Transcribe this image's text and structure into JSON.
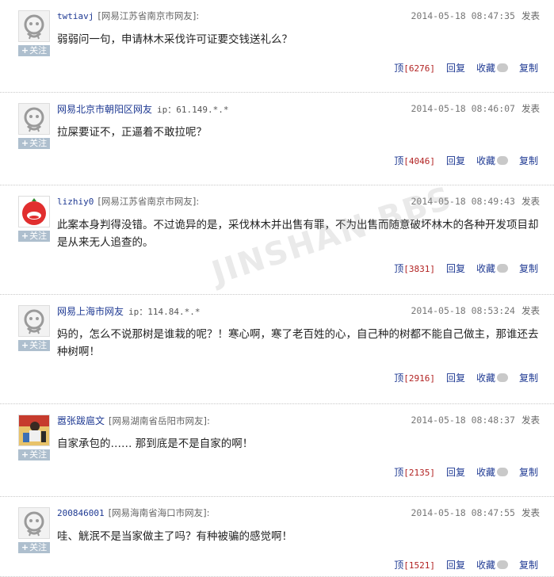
{
  "follow_label": "关注",
  "actions": {
    "ding": "顶",
    "reply": "回复",
    "collect": "收藏",
    "copy": "复制"
  },
  "publish_label": "发表",
  "watermark": "JINSHAN BBS",
  "comments": [
    {
      "user": "twtiavj",
      "location": "[网易江苏省南京市网友]:",
      "ip": "",
      "time": "2014-05-18 08:47:35",
      "content": "弱弱问一句，申请林木采伐许可证要交钱送礼么？",
      "ding": "[6276]",
      "avatar": "default"
    },
    {
      "user": "网易北京市朝阳区网友",
      "location": "",
      "ip": "ip：61.149.*.*",
      "time": "2014-05-18 08:46:07",
      "content": "拉屎要证不，正逼着不敢拉呢？",
      "ding": "[4046]",
      "avatar": "default"
    },
    {
      "user": "lizhiy0",
      "location": "[网易江苏省南京市网友]:",
      "ip": "",
      "time": "2014-05-18 08:49:43",
      "content": "此案本身判得没错。不过诡异的是，采伐林木并出售有罪，不为出售而随意破坏林木的各种开发项目却是从来无人追查的。",
      "ding": "[3831]",
      "avatar": "red"
    },
    {
      "user": "网易上海市网友",
      "location": "",
      "ip": "ip：114.84.*.*",
      "time": "2014-05-18 08:53:24",
      "content": "妈的，怎么不说那树是谁栽的呢？！寒心啊，寒了老百姓的心，自己种的树都不能自己做主，那谁还去种树啊！",
      "ding": "[2916]",
      "avatar": "default"
    },
    {
      "user": "嚣张跋扈文",
      "location": "[网易湖南省岳阳市网友]:",
      "ip": "",
      "time": "2014-05-18 08:48:37",
      "content": "自家承包的…… 那到底是不是自家的啊！",
      "ding": "[2135]",
      "avatar": "photo"
    },
    {
      "user": "200846001",
      "location": "[网易海南省海口市网友]:",
      "ip": "",
      "time": "2014-05-18 08:47:55",
      "content": "哇、觥泯不是当家做主了吗？有种被骗的感觉啊！",
      "ding": "[1521]",
      "avatar": "default"
    }
  ]
}
